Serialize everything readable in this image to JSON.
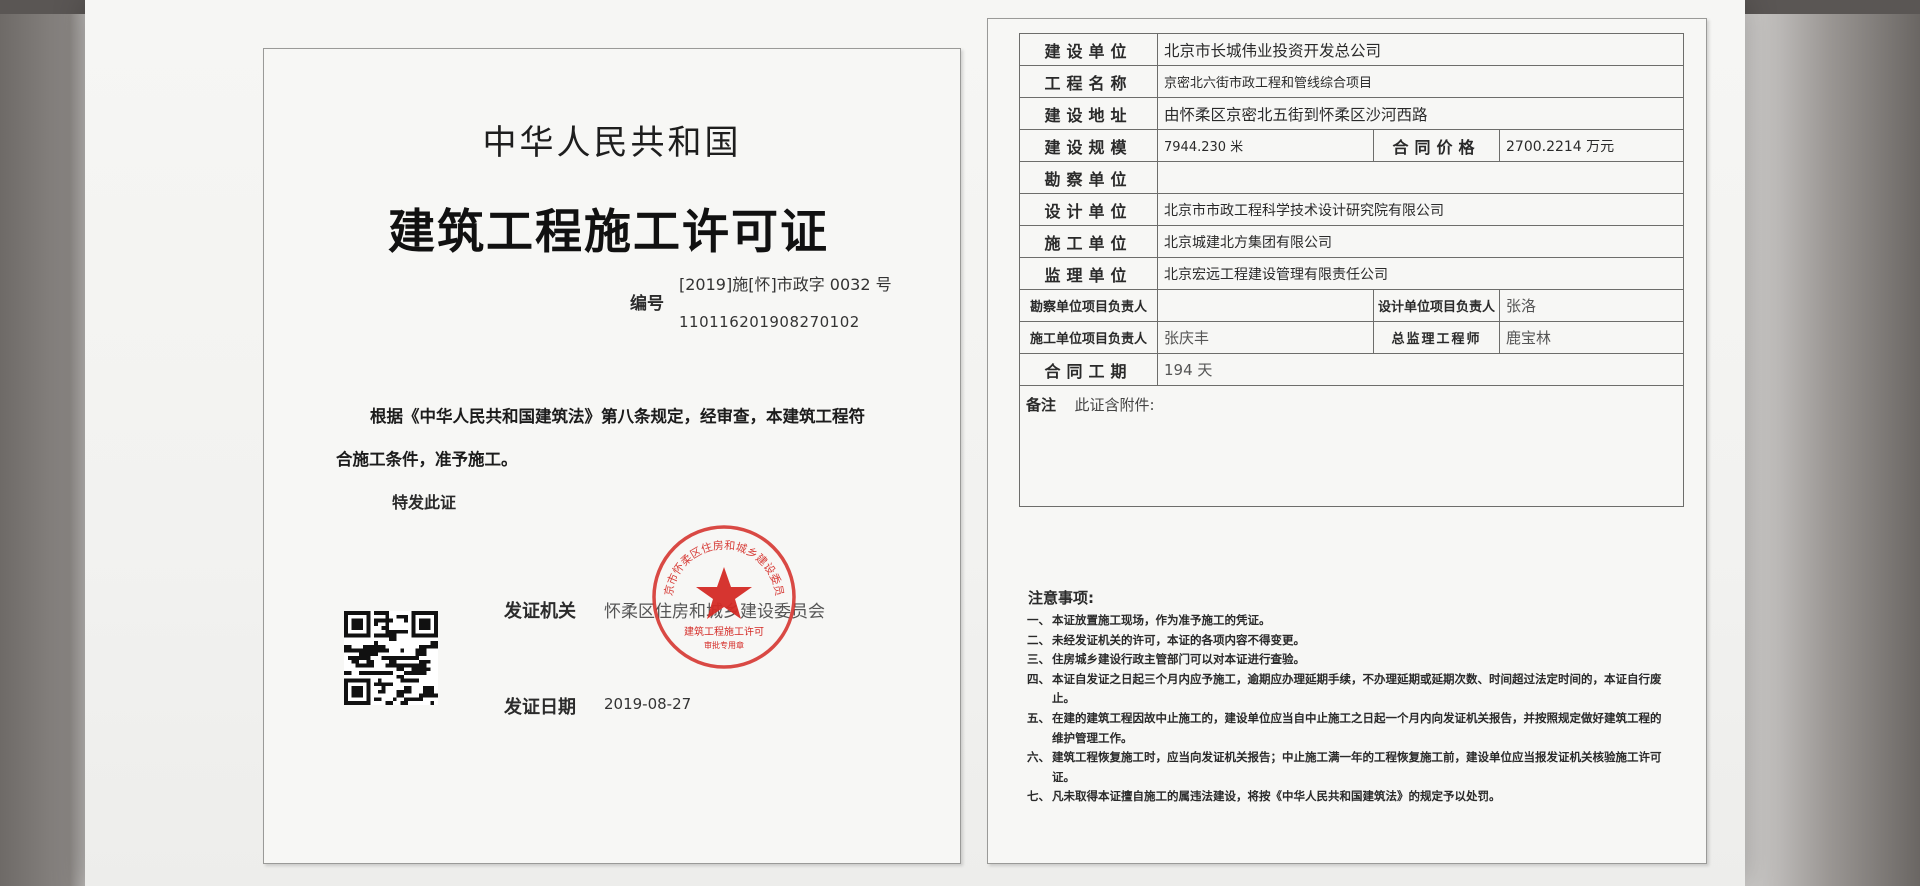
{
  "left": {
    "country": "中华人民共和国",
    "title": "建筑工程施工许可证",
    "number_label": "编号",
    "number_line1": "[2019]施[怀]市政字 0032 号",
    "number_line2": "110116201908270102",
    "body_line1": "根据《中华人民共和国建筑法》第八条规定，经审查，本建筑工程符",
    "body_line2": "合施工条件，准予施工。",
    "special": "特发此证",
    "issuer_label": "发证机关",
    "issuer_value": "怀柔区住房和城乡建设委员会",
    "date_label": "发证日期",
    "date_value": "2019-08-27",
    "seal_color": "#d42a25",
    "seal_text": {
      "top": "北京市怀柔区住房和城乡建设委员会",
      "bottom1": "建筑工程施工许可",
      "bottom2": "审批专用章"
    },
    "qr_icon": "qr-code-icon"
  },
  "table": {
    "builder_label": "建设单位",
    "builder_value": "北京市长城伟业投资开发总公司",
    "project_label": "工程名称",
    "project_value": "京密北六街市政工程和管线综合项目",
    "address_label": "建设地址",
    "address_value": "由怀柔区京密北五街到怀柔区沙河西路",
    "scale_label": "建设规模",
    "scale_value": "7944.230 米",
    "contract_price_label": "合同价格",
    "contract_price_value": "2700.2214 万元",
    "survey_label": "勘察单位",
    "survey_value": "",
    "design_label": "设计单位",
    "design_value": "北京市市政工程科学技术设计研究院有限公司",
    "construction_label": "施工单位",
    "construction_value": "北京城建北方集团有限公司",
    "supervision_label": "监理单位",
    "supervision_value": "北京宏远工程建设管理有限责任公司",
    "survey_lead_label": "勘察单位项目负责人",
    "survey_lead_value": "",
    "design_lead_label": "设计单位项目负责人",
    "design_lead_value": "张洛",
    "construction_lead_label": "施工单位项目负责人",
    "construction_lead_value": "张庆丰",
    "chief_supervisor_label": "总监理工程师",
    "chief_supervisor_value": "鹿宝林",
    "period_label": "合同工期",
    "period_value": "194 天",
    "remarks_label": "备注",
    "remarks_value": "此证含附件:"
  },
  "notes": {
    "title": "注意事项:",
    "items": [
      {
        "prefix": "一、",
        "text": "本证放置施工现场，作为准予施工的凭证。"
      },
      {
        "prefix": "二、",
        "text": "未经发证机关的许可，本证的各项内容不得变更。"
      },
      {
        "prefix": "三、",
        "text": "住房城乡建设行政主管部门可以对本证进行查验。"
      },
      {
        "prefix": "四、",
        "text": "本证自发证之日起三个月内应予施工，逾期应办理延期手续，不办理延期或延期次数、时间超过法定时间的，本证自行废止。"
      },
      {
        "prefix": "五、",
        "text": "在建的建筑工程因故中止施工的，建设单位应当自中止施工之日起一个月内向发证机关报告，并按照规定做好建筑工程的维护管理工作。"
      },
      {
        "prefix": "六、",
        "text": "建筑工程恢复施工时，应当向发证机关报告；中止施工满一年的工程恢复施工前，建设单位应当报发证机关核验施工许可证。"
      },
      {
        "prefix": "七、",
        "text": "凡未取得本证擅自施工的属违法建设，将按《中华人民共和国建筑法》的规定予以处罚。"
      }
    ]
  }
}
